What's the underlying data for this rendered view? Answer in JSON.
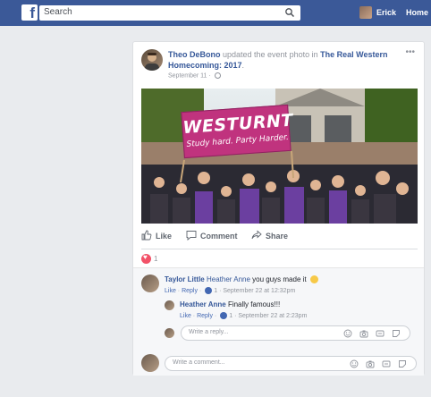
{
  "topbar": {
    "logo": "f",
    "search_placeholder": "Search",
    "user_name": "Erick",
    "home_label": "Home"
  },
  "post": {
    "author": "Theo DeBono",
    "action_text": " updated the event photo in ",
    "event_name": "The Real Western Homecoming: 2017",
    "event_suffix": ".",
    "date": "September 11 · ",
    "photo": {
      "banner_title": "WESTURNT",
      "banner_subtitle": "Study hard. Party Harder."
    },
    "actions": {
      "like": "Like",
      "comment": "Comment",
      "share": "Share"
    },
    "reaction_count": "1"
  },
  "comments": [
    {
      "author": "Taylor Little",
      "mention": "Heather Anne",
      "text": " you guys made it ",
      "meta_like": "Like",
      "meta_reply": "Reply",
      "likes": "1",
      "time": "September 22 at 12:32pm"
    },
    {
      "author": "Heather Anne",
      "text": " Finally famous!!!",
      "meta_like": "Like",
      "meta_reply": "Reply",
      "likes": "1",
      "time": "September 22 at 2:23pm"
    }
  ],
  "reply_input": {
    "placeholder": "Write a reply..."
  },
  "comment_input": {
    "placeholder": "Write a comment..."
  },
  "colors": {
    "topbar": "#3b5998",
    "link": "#365899",
    "banner": "#c0337e"
  }
}
